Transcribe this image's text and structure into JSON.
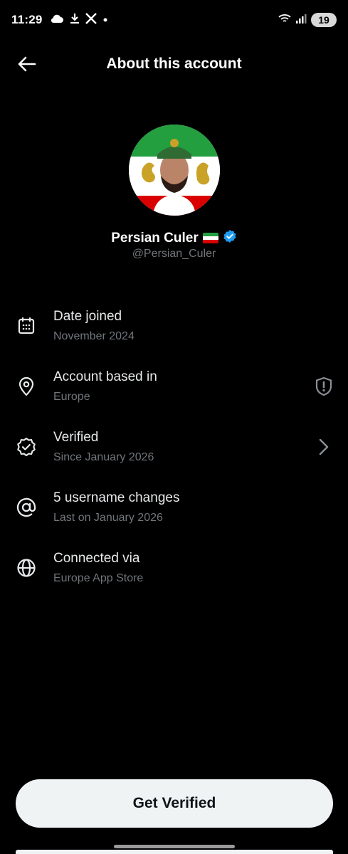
{
  "status_bar": {
    "time": "11:29",
    "left_icons": [
      "cloud-icon",
      "download-icon",
      "x-logo-icon",
      "dot-icon"
    ],
    "right_icons": [
      "wifi-icon",
      "signal-icon"
    ],
    "battery_level": "19"
  },
  "header": {
    "title": "About this account",
    "back_icon": "arrow-left-icon"
  },
  "profile": {
    "name": "Persian Culer",
    "handle": "@Persian_Culer",
    "verified": true,
    "verified_color": "#1d9bf0",
    "flag_icon": "iran-lion-and-sun-flag-icon"
  },
  "info_items": [
    {
      "icon": "calendar-icon",
      "title": "Date joined",
      "subtitle": "November 2024",
      "trailing": ""
    },
    {
      "icon": "location-pin-icon",
      "title": "Account based in",
      "subtitle": "Europe",
      "trailing": "shield-alert-icon"
    },
    {
      "icon": "verified-badge-outline-icon",
      "title": "Verified",
      "subtitle": "Since January 2026",
      "trailing": "chevron-right-icon"
    },
    {
      "icon": "at-sign-icon",
      "title": "5 username changes",
      "subtitle": "Last on January 2026",
      "trailing": ""
    },
    {
      "icon": "globe-icon",
      "title": "Connected via",
      "subtitle": "Europe App Store",
      "trailing": ""
    }
  ],
  "footer": {
    "get_verified_label": "Get Verified"
  },
  "colors": {
    "background": "#000000",
    "primary_text": "#e7e9ea",
    "secondary_text": "#71767b",
    "button_bg": "#eff3f4"
  }
}
